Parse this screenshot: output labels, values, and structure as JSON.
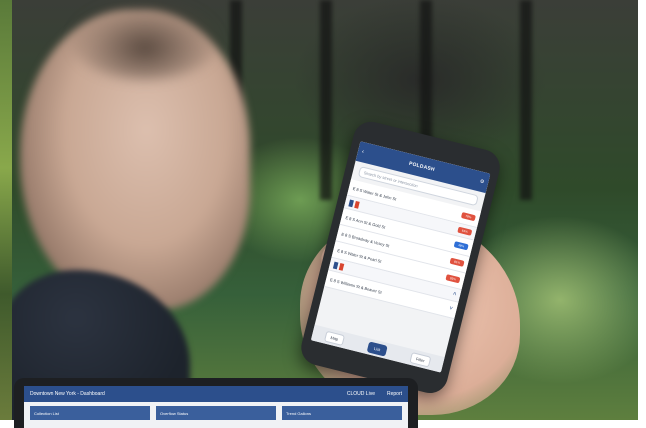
{
  "phone": {
    "title": "POLDASH",
    "search_placeholder": "Search by street or intersection",
    "rows": [
      {
        "label": "E 8 S Water St & John St",
        "badge": "78%"
      },
      {
        "label": "E 8 S Ann St & Gold St",
        "badge": "64%"
      },
      {
        "label": "E 8 S Broadway & Vesey St",
        "badge": "81%"
      },
      {
        "label": "E 8 S Water St & Pearl St",
        "badge": "48%"
      },
      {
        "label": "E 8 S Williams St & Beaver St",
        "badge": "93%"
      }
    ],
    "tabs": {
      "map": "Map",
      "list": "List",
      "filter": "Filter"
    }
  },
  "laptop": {
    "title": "Downtown New York - Dashboard",
    "user": "CLOUD Live",
    "report": "Report",
    "cards": [
      "Collection List",
      "Overflow Status",
      "Trend Gallons"
    ]
  },
  "colors": {
    "brand": "#2c4f8c",
    "alert": "#e0523f",
    "ok": "#2f6fd6"
  }
}
